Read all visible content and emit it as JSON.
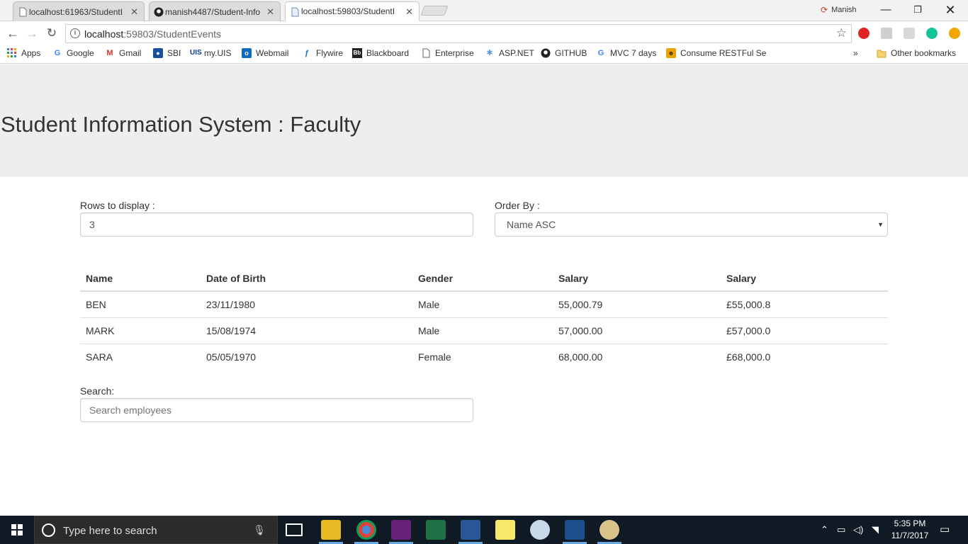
{
  "browser": {
    "tabs": [
      {
        "label": "localhost:61963/StudentI",
        "active": false
      },
      {
        "label": "manish4487/Student-Info",
        "active": false
      },
      {
        "label": "localhost:59803/StudentI",
        "active": true
      }
    ],
    "profile_name": "Manish",
    "url_host": "localhost",
    "url_rest": ":59803/StudentEvents",
    "bookmarks": [
      {
        "label": "Apps",
        "icon": "apps-grid-icon"
      },
      {
        "label": "Google",
        "icon": "google-icon"
      },
      {
        "label": "Gmail",
        "icon": "gmail-icon"
      },
      {
        "label": "SBI",
        "icon": "sbi-icon"
      },
      {
        "label": "my.UIS",
        "icon": "uis-icon"
      },
      {
        "label": "Webmail",
        "icon": "outlook-icon"
      },
      {
        "label": "Flywire",
        "icon": "flywire-icon"
      },
      {
        "label": "Blackboard",
        "icon": "blackboard-icon"
      },
      {
        "label": "Enterprise",
        "icon": "page-icon"
      },
      {
        "label": "ASP.NET",
        "icon": "aspnet-icon"
      },
      {
        "label": "GITHUB",
        "icon": "github-icon"
      },
      {
        "label": "MVC 7 days",
        "icon": "google-icon"
      },
      {
        "label": "Consume RESTFul Se",
        "icon": "folder-person-icon"
      }
    ],
    "overflow_label": "»",
    "other_bookmarks": "Other bookmarks"
  },
  "page": {
    "title": "Student Information System : Faculty",
    "rows_label": "Rows to display :",
    "rows_value": "3",
    "order_label": "Order By :",
    "order_value": "Name ASC",
    "table": {
      "headers": [
        "Name",
        "Date of Birth",
        "Gender",
        "Salary",
        "Salary"
      ],
      "rows": [
        [
          "BEN",
          "23/11/1980",
          "Male",
          "55,000.79",
          "£55,000.8"
        ],
        [
          "MARK",
          "15/08/1974",
          "Male",
          "57,000.00",
          "£57,000.0"
        ],
        [
          "SARA",
          "05/05/1970",
          "Female",
          "68,000.00",
          "£68,000.0"
        ]
      ]
    },
    "search_label": "Search:",
    "search_placeholder": "Search employees"
  },
  "taskbar": {
    "search_text": "Type here to search",
    "time": "5:35 PM",
    "date": "11/7/2017"
  },
  "colors": {
    "jumbotron": "#eeeeee",
    "taskbar": "#101a24",
    "table_border": "#dddddd"
  }
}
